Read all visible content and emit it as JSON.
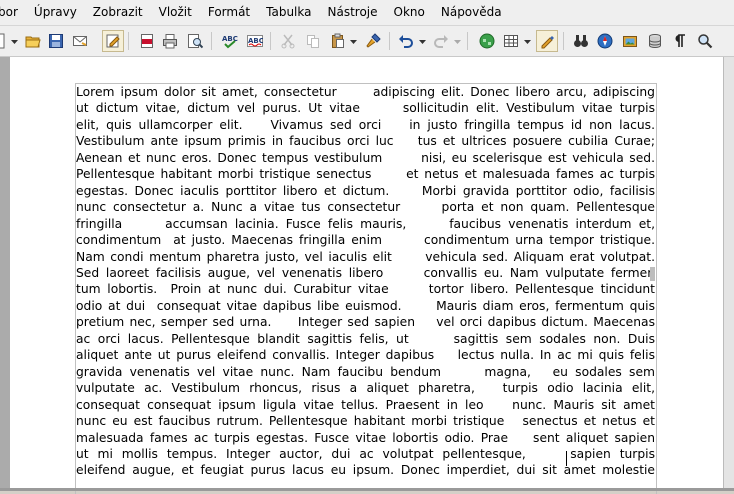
{
  "menubar": {
    "items": [
      "bor",
      "Úpravy",
      "Zobrazit",
      "Vložit",
      "Formát",
      "Tabulka",
      "Nástroje",
      "Okno",
      "Nápověda"
    ]
  },
  "toolbar": {
    "icons": [
      "new-document-icon",
      "open-folder-icon",
      "save-icon",
      "email-icon",
      "edit-mode-icon",
      "export-pdf-icon",
      "print-icon",
      "page-preview-icon",
      "spellcheck-icon",
      "autospellcheck-icon",
      "cut-icon",
      "copy-icon",
      "paste-icon",
      "format-paintbrush-icon",
      "undo-icon",
      "redo-icon",
      "navigator-globe-icon",
      "table-icon",
      "draw-functions-icon",
      "find-binoculars-icon",
      "navigator-compass-icon",
      "gallery-icon",
      "data-sources-icon",
      "formatting-marks-icon",
      "zoom-icon"
    ]
  },
  "document": {
    "lines": [
      "Lorem ipsum dolor sit amet, consectetur      adipiscing elit. Donec libero arcu, adipiscing",
      "ut dictum vitae, dictum vel purus. Ut vitae      sollicitudin elit. Vestibulum vitae turpis",
      "elit, quis ullamcorper elit.    Vivamus sed orci    in justo fringilla tempus id non lacus.",
      "Vestibulum ante ipsum primis in faucibus orci luc    tus et ultrices posuere cubilia Curae;",
      "Aenean et nunc eros. Donec tempus vestibulum       nisi, eu scelerisque est vehicula sed.",
      "Pellentesque habitant morbi tristique senectus      et netus et malesuada fames ac turpis",
      "egestas. Donec iaculis porttitor libero et dictum.     Morbi gravida porttitor odio, facilisis",
      "nunc consectetur a. Nunc a vitae tus consectetur      porta et non quam. Pellentesque",
      "fringilla      accumsan lacinia. Fusce felis mauris,      faucibus venenatis interdum et,",
      "condimentum  at justo. Maecenas fringilla enim       condimentum urna tempor tristique.",
      "Nam condi mentum pharetra justo, vel iaculis elit      vehicula sed. Aliquam erat volutpat.",
      "Sed laoreet facilisis augue, vel venenatis libero      convallis eu. Nam vulputate fermen",
      "tum lobortis.  Proin at nunc dui. Curabitur vitae      tortor libero. Pellentesque tincidunt",
      "odio at dui  consequat vitae dapibus libe euismod.      Mauris diam eros, fermentum quis",
      "pretium nec, semper sed urna.     Integer sed sapien    vel orci dapibus dictum. Maecenas",
      "ac orci lacus. Pellentesque blandit sagittis felis, ut      sagittis sem sodales non. Duis",
      "aliquet ante ut purus eleifend convallis. Integer dapibus    lectus nulla. In ac mi quis felis",
      "gravida venenatis vel vitae nunc. Nam faucibu bendum      magna,   eu sodales sem",
      "vulputate ac. Vestibulum rhoncus, risus a aliquet pharetra,   turpis odio lacinia elit,",
      "consequat consequat ipsum ligula vitae tellus. Praesent in leo    nunc. Mauris sit amet",
      "nunc eu est faucibus rutrum. Pellentesque habitant morbi tristique   senectus et netus et",
      "malesuada fames ac turpis egestas. Fusce vitae lobortis odio. Prae    sent aliquet sapien",
      "ut mi mollis tempus. Integer auctor, dui ac volutpat pellentesque,     sapien turpis",
      "eleifend augue, et feugiat purus lacus eu ipsum. Donec imperdiet, dui sit amet molestie"
    ]
  },
  "colors": {
    "menubar_bg": "#efefef",
    "toolbar_bg": "#efefef",
    "workarea_bg": "#ababab",
    "page_bg": "#ffffff"
  }
}
